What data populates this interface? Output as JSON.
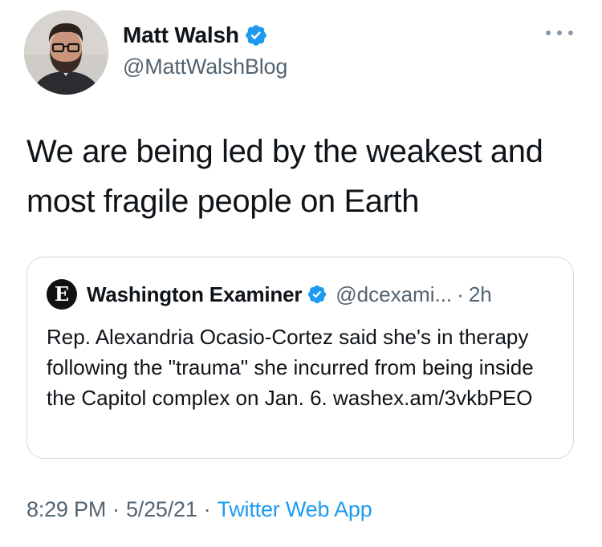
{
  "tweet": {
    "author": {
      "name": "Matt Walsh",
      "handle": "@MattWalshBlog",
      "verified": true,
      "avatar_icon": "person-avatar"
    },
    "more_icon": "more-horizontal-icon",
    "text": "We are being led by the weakest and most fragile people on Earth",
    "quoted": {
      "logo_icon": "washington-examiner-logo",
      "logo_letter": "E",
      "name": "Washington Examiner",
      "verified": true,
      "handle": "@dcexami...",
      "separator": "·",
      "time": "2h",
      "text": "Rep. Alexandria Ocasio-Cortez said she's in therapy following the \"trauma\" she incurred from being inside the Capitol complex on Jan. 6. washex.am/3vkbPEO"
    },
    "meta": {
      "time": "8:29 PM",
      "date": "5/25/21",
      "separator": "·",
      "app": "Twitter Web App"
    }
  },
  "colors": {
    "text_primary": "#0f1419",
    "text_secondary": "#536471",
    "accent": "#1d9bf0",
    "border": "#cfd9de"
  }
}
